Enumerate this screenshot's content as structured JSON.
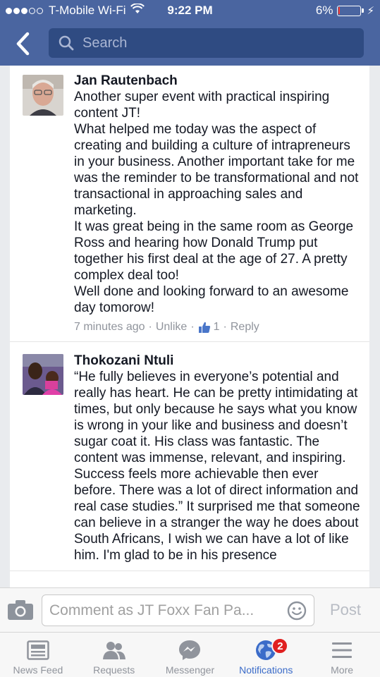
{
  "status_bar": {
    "carrier": "T-Mobile Wi-Fi",
    "time": "9:22 PM",
    "battery": "6%",
    "battery_level": 0.06
  },
  "header": {
    "search_placeholder": "Search"
  },
  "comments": [
    {
      "author": "Jan Rautenbach",
      "text": "Another super event with practical inspiring content JT!\nWhat helped me today was the aspect of creating and building a culture of intrapreneurs in your business. Another important take for me was the reminder to be transformational and not transactional in approaching sales and marketing.\nIt was great being in the same room as George Ross and hearing how Donald Trump put together his first deal at the age of 27. A pretty complex deal too!\nWell done and looking forward to an awesome day tomorow!",
      "time": "7 minutes ago",
      "unlike_label": "Unlike",
      "like_count": "1",
      "reply_label": "Reply"
    },
    {
      "author": "Thokozani Ntuli",
      "text": "“He fully believes in everyone’s potential and really has heart. He can be pretty intimidating at times, but only because he says what you know is wrong in your like and business and doesn’t sugar coat it. His class was fantastic. The content was immense, relevant, and inspiring. Success feels more achievable then ever before. There was a lot of direct information and real case studies.” It surprised me that someone can believe in a stranger the way he does about South Africans, I wish we can have a lot of like him. I'm glad to be in his presence"
    }
  ],
  "composer": {
    "placeholder": "Comment as JT Foxx Fan Pa...",
    "post_label": "Post"
  },
  "tabs": [
    {
      "label": "News Feed",
      "icon": "news-feed-icon"
    },
    {
      "label": "Requests",
      "icon": "requests-icon"
    },
    {
      "label": "Messenger",
      "icon": "messenger-icon"
    },
    {
      "label": "Notifications",
      "icon": "globe-icon",
      "badge": "2",
      "active": true
    },
    {
      "label": "More",
      "icon": "menu-icon"
    }
  ],
  "colors": {
    "header_bg": "#4a65a0",
    "active_tab": "#3b6cc9",
    "badge": "#e02020"
  }
}
